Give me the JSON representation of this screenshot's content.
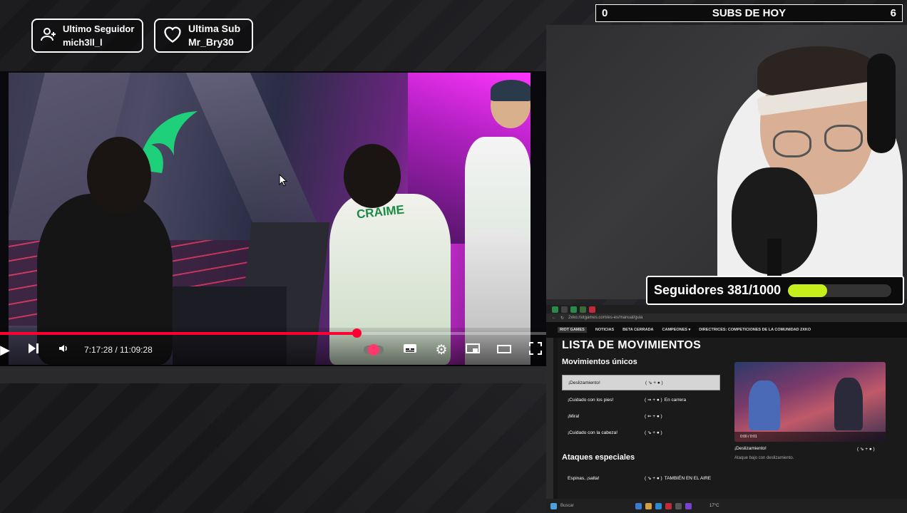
{
  "badges": {
    "follower_title": "Ultimo Seguidor",
    "follower_name": "mich3ll_l",
    "sub_title": "Ultima Sub",
    "sub_name": "Mr_Bry30"
  },
  "subs": {
    "left": "0",
    "title": "SUBS DE HOY",
    "right": "6"
  },
  "video": {
    "current_time": "7:17:28",
    "duration": "11:09:28",
    "time_display": "7:17:28 / 11:09:28",
    "progress_fraction": 0.653,
    "jersey_text": "CRAIME"
  },
  "followers": {
    "label": "Seguidores 381/1000",
    "fraction": 0.381
  },
  "browser": {
    "url": "2xko.riotgames.com/es-es/manual/guia",
    "nav": [
      "NOTICIAS",
      "BETA CERRADA",
      "CAMPEONES ▾",
      "DIRECTRICES: COMPETICIONES DE LA COMUNIDAD 2XKO"
    ],
    "page_title": "LISTA DE MOVIMIENTOS",
    "section1": "Movimientos únicos",
    "moves": [
      {
        "name": "¡Deslizamiento!",
        "input": "( ⇘ + ● )",
        "extra": ""
      },
      {
        "name": "¡Cuidado con los pies!",
        "input": "( ⇒ + ● )",
        "extra": "En carrera"
      },
      {
        "name": "¡Mira!",
        "input": "( ⇐ + ● )",
        "extra": ""
      },
      {
        "name": "¡Cuidado con la cabeza!",
        "input": "( ⇘ + ● )",
        "extra": ""
      }
    ],
    "section2": "Ataques especiales",
    "special": {
      "name": "Espinas, ¡salta!",
      "input": "( ⇘ + ● )",
      "extra": "TAMBIÉN EN EL AIRE"
    },
    "preview_time": "0:00 / 0:01",
    "preview_caption": "¡Deslizamiento!",
    "preview_input": "( ⇘ + ● )",
    "preview_desc": "Ataque bajo con deslizamiento.",
    "search_placeholder": "Buscar",
    "weather": "17°C"
  },
  "colors": {
    "accent_red": "#ff0033",
    "follower_bar": "#c6f01b",
    "move_circle": "#7a3fd6"
  }
}
